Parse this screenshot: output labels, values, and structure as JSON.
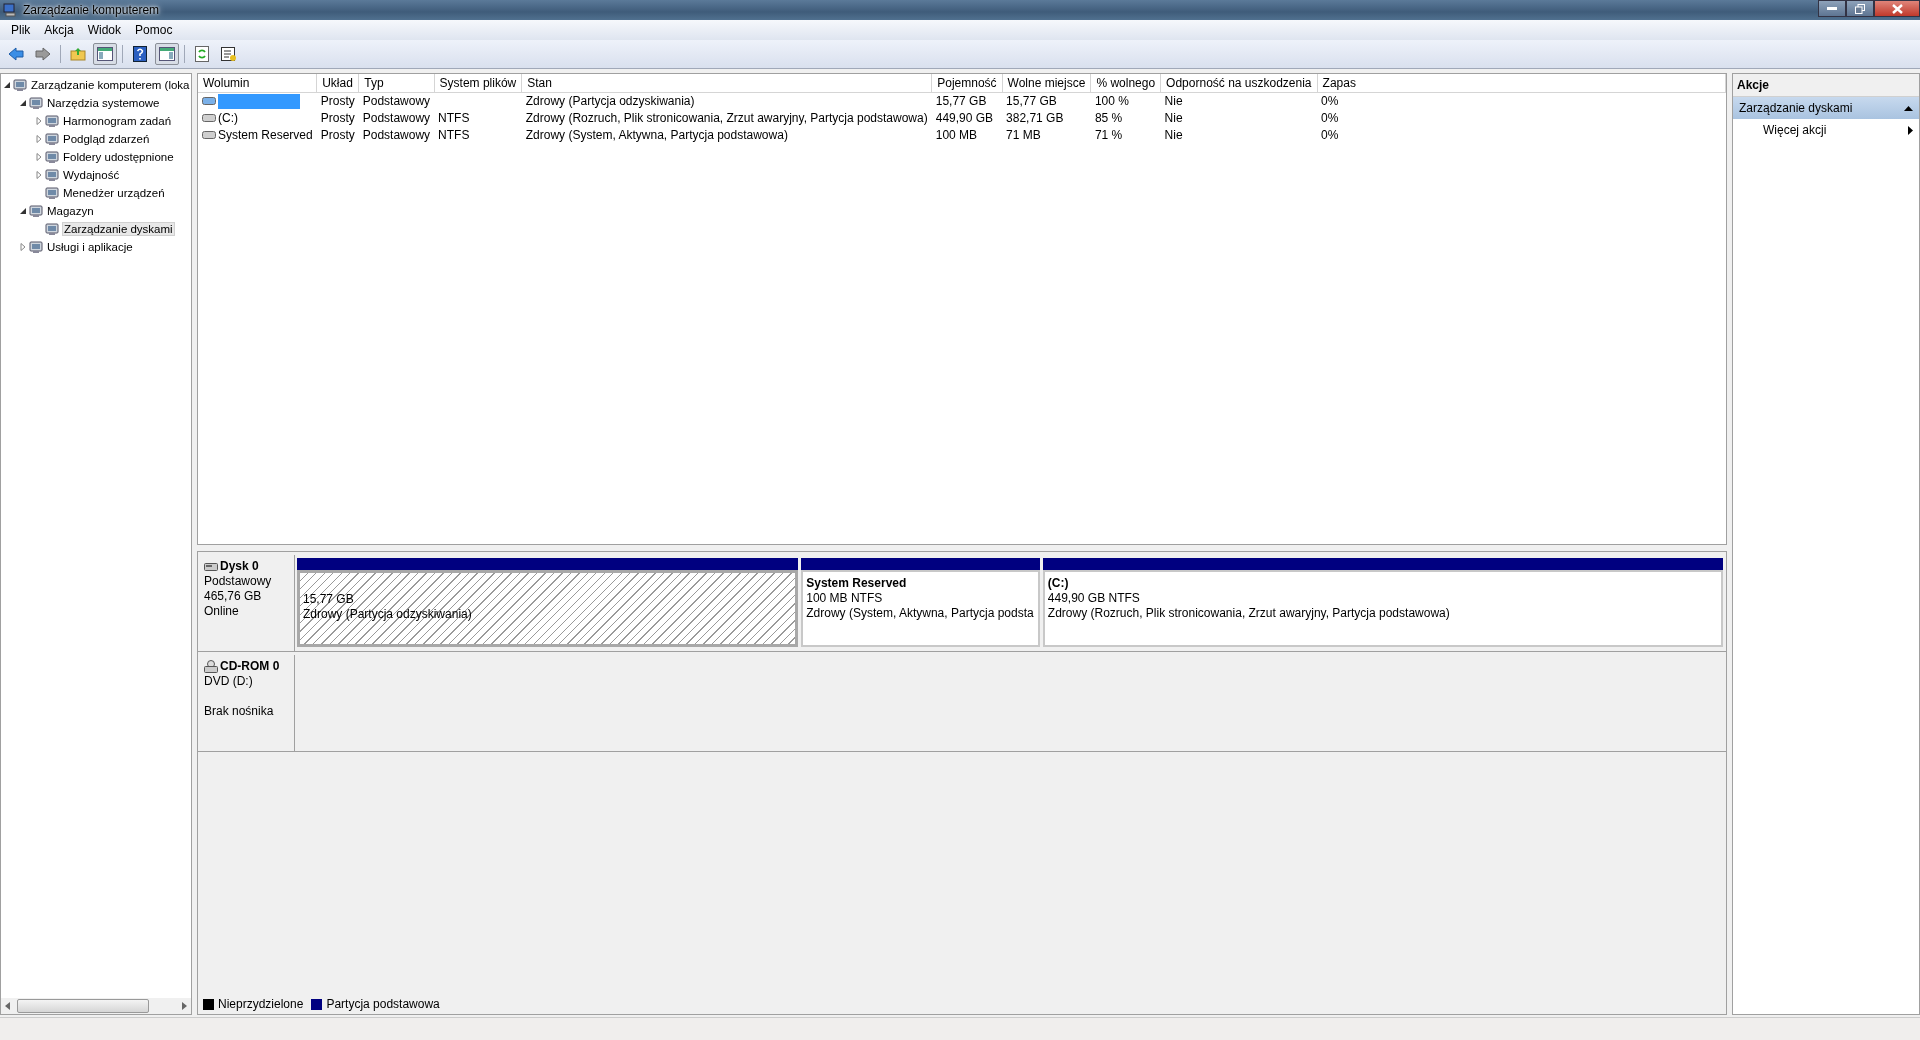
{
  "window": {
    "title": "Zarządzanie komputerem"
  },
  "menu": [
    "Plik",
    "Akcja",
    "Widok",
    "Pomoc"
  ],
  "tree": [
    {
      "label": "Zarządzanie komputerem (loka",
      "expanded": true,
      "selected": false,
      "children": [
        {
          "label": "Narzędzia systemowe",
          "expanded": true,
          "selected": false,
          "children": [
            {
              "label": "Harmonogram zadań",
              "expanded": false,
              "selected": false
            },
            {
              "label": "Podgląd zdarzeń",
              "expanded": false,
              "selected": false
            },
            {
              "label": "Foldery udostępnione",
              "expanded": false,
              "selected": false
            },
            {
              "label": "Wydajność",
              "expanded": false,
              "selected": false
            },
            {
              "label": "Menedżer urządzeń",
              "selected": false
            }
          ]
        },
        {
          "label": "Magazyn",
          "expanded": true,
          "selected": false,
          "children": [
            {
              "label": "Zarządzanie dyskami",
              "selected": true
            }
          ]
        },
        {
          "label": "Usługi i aplikacje",
          "expanded": false,
          "selected": false
        }
      ]
    }
  ],
  "volumes": {
    "columns": [
      "Wolumin",
      "Układ",
      "Typ",
      "System plików",
      "Stan",
      "Pojemność",
      "Wolne miejsce",
      "% wolnego",
      "Odporność na uszkodzenia",
      "Zapas"
    ],
    "rows": [
      {
        "selected": true,
        "cells": [
          "",
          "Prosty",
          "Podstawowy",
          "",
          "Zdrowy (Partycja odzyskiwania)",
          "15,77 GB",
          "15,77 GB",
          "100 %",
          "Nie",
          "0%"
        ]
      },
      {
        "selected": false,
        "cells": [
          "(C:)",
          "Prosty",
          "Podstawowy",
          "NTFS",
          "Zdrowy (Rozruch, Plik stronicowania, Zrzut awaryjny, Partycja podstawowa)",
          "449,90 GB",
          "382,71 GB",
          "85 %",
          "Nie",
          "0%"
        ]
      },
      {
        "selected": false,
        "cells": [
          "System Reserved",
          "Prosty",
          "Podstawowy",
          "NTFS",
          "Zdrowy (System, Aktywna, Partycja podstawowa)",
          "100 MB",
          "71 MB",
          "71 %",
          "Nie",
          "0%"
        ]
      }
    ]
  },
  "disks": [
    {
      "kind": "disk",
      "name": "Dysk 0",
      "lines": [
        "Podstawowy",
        "465,76 GB",
        "Online"
      ],
      "partitions": [
        {
          "selected": true,
          "size": "15,77 GB",
          "status": "Zdrowy (Partycja odzyskiwania)"
        },
        {
          "selected": false,
          "name": "System Reserved",
          "size": "100 MB NTFS",
          "status": "Zdrowy (System, Aktywna, Partycja podsta"
        },
        {
          "selected": false,
          "name": "(C:)",
          "size": "449,90 GB NTFS",
          "status": "Zdrowy (Rozruch, Plik stronicowania, Zrzut awaryjny, Partycja podstawowa)"
        }
      ]
    },
    {
      "kind": "cdrom",
      "name": "CD-ROM 0",
      "lines": [
        "DVD (D:)",
        "Brak nośnika"
      ]
    }
  ],
  "legend": [
    {
      "label": "Nieprzydzielone",
      "color": "#000000"
    },
    {
      "label": "Partycja podstawowa",
      "color": "#000080"
    }
  ],
  "actions": {
    "title": "Akcje",
    "section": "Zarządzanie dyskami",
    "items": [
      "Więcej akcji"
    ]
  }
}
